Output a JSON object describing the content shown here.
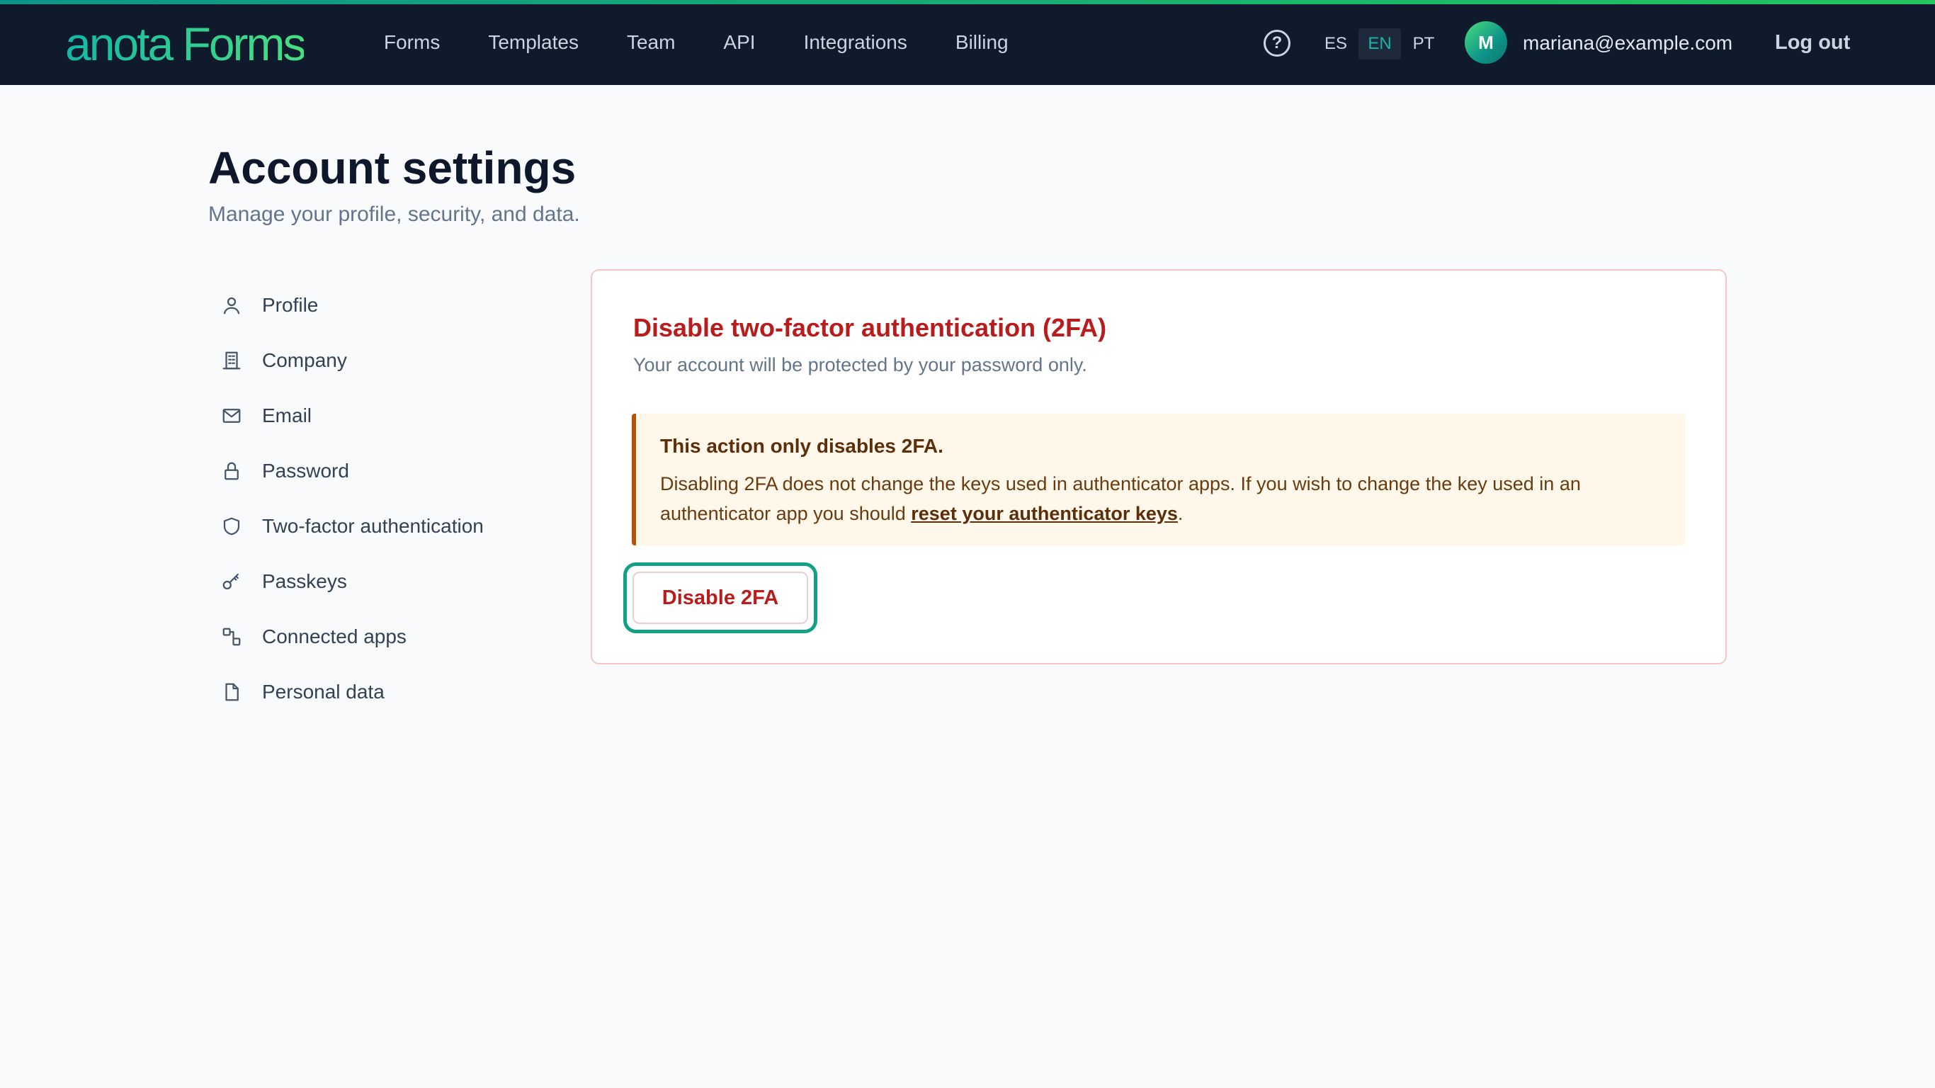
{
  "brand": {
    "logo_text": "anota Forms",
    "accent_gradient": [
      "#0d9488",
      "#22c55e"
    ]
  },
  "header": {
    "nav": [
      "Forms",
      "Templates",
      "Team",
      "API",
      "Integrations",
      "Billing"
    ],
    "help_icon": "help-circle-icon",
    "help_glyph": "?",
    "languages": [
      "ES",
      "EN",
      "PT"
    ],
    "active_language": "EN",
    "avatar_initial": "M",
    "user_email": "mariana@example.com",
    "logout_label": "Log out"
  },
  "page": {
    "title": "Account settings",
    "subtitle": "Manage your profile, security, and data."
  },
  "sidebar": {
    "items": [
      {
        "label": "Profile",
        "icon": "user-icon"
      },
      {
        "label": "Company",
        "icon": "building-icon"
      },
      {
        "label": "Email",
        "icon": "mail-icon"
      },
      {
        "label": "Password",
        "icon": "lock-icon"
      },
      {
        "label": "Two-factor authentication",
        "icon": "shield-icon"
      },
      {
        "label": "Passkeys",
        "icon": "key-icon"
      },
      {
        "label": "Connected apps",
        "icon": "connection-icon"
      },
      {
        "label": "Personal data",
        "icon": "document-icon"
      }
    ]
  },
  "card": {
    "title": "Disable two-factor authentication (2FA)",
    "subtitle": "Your account will be protected by your password only.",
    "warning_title": "This action only disables 2FA.",
    "warning_body_before": "Disabling 2FA does not change the keys used in authenticator apps. If you wish to change the key used in an authenticator app you should ",
    "warning_link": "reset your authenticator keys",
    "warning_body_after": ".",
    "button_label": "Disable 2FA",
    "danger_color": "#b91c1c",
    "focus_ring_color": "#14a085"
  }
}
